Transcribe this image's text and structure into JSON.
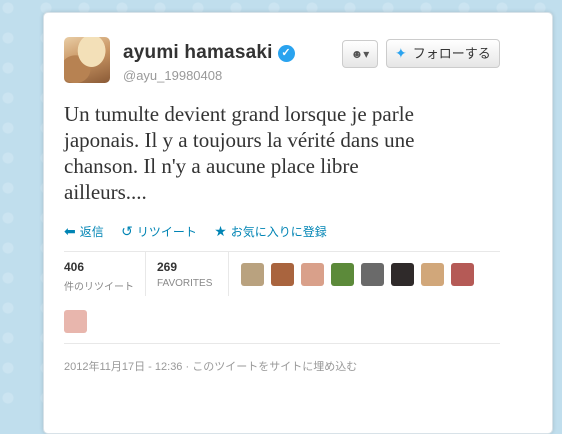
{
  "profile": {
    "name": "ayumi hamasaki",
    "handle": "@ayu_19980408",
    "verified_icon": "verified-check-icon"
  },
  "buttons": {
    "user_menu_icon": "user-dropdown-icon",
    "follow_label": "フォローする"
  },
  "tweet": {
    "lines": [
      "Un tumulte devient grand lorsque je parle",
      "japonais. Il y a toujours la vérité dans une",
      "chanson. Il n'y a aucune place libre",
      "ailleurs...."
    ]
  },
  "actions": {
    "reply": "返信",
    "retweet": "リツイート",
    "favorite": "お気に入りに登録"
  },
  "stats": {
    "retweets": {
      "count": "406",
      "label": "件のリツイート"
    },
    "favorites": {
      "count": "269",
      "label": "FAVORITES"
    }
  },
  "favoriters": [
    {
      "color": "#b9a27f"
    },
    {
      "color": "#a9643e"
    },
    {
      "color": "#d9a08a"
    },
    {
      "color": "#5c8a3a"
    },
    {
      "color": "#6a6a6a"
    },
    {
      "color": "#2f2a2a"
    },
    {
      "color": "#d1a77a"
    },
    {
      "color": "#b55a56"
    },
    {
      "color": "#e8b6ad"
    }
  ],
  "timestamp": "2012年11月17日 - 12:36 · このツイートをサイトに埋め込む",
  "colors": {
    "background": "#c0deed",
    "link": "#0084b4",
    "verified": "#2aa3ef"
  }
}
